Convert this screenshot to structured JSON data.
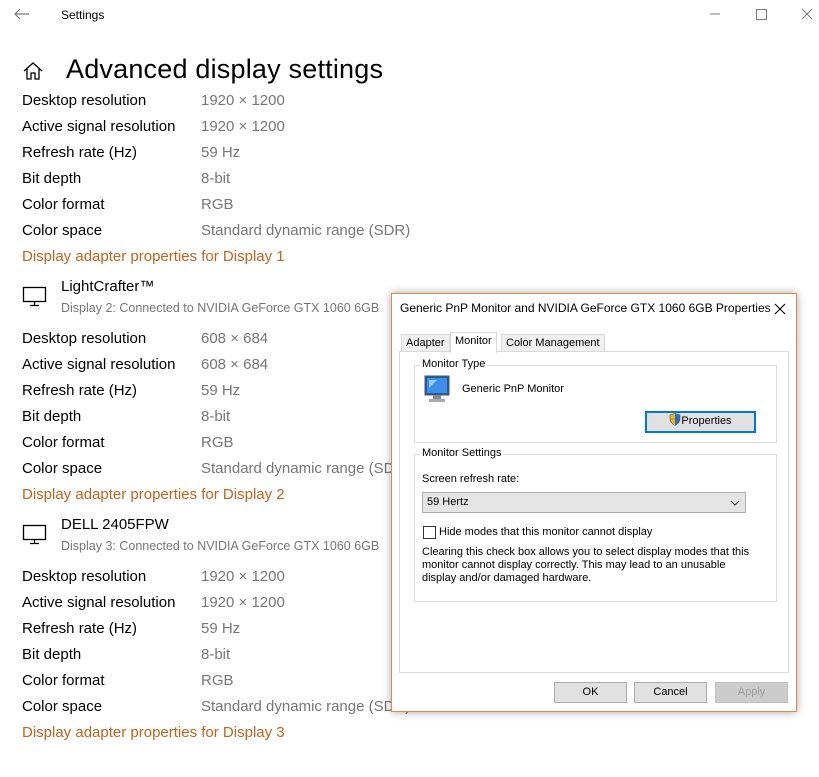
{
  "window": {
    "title": "Settings"
  },
  "page": {
    "title": "Advanced display settings"
  },
  "labels": {
    "desktop_resolution": "Desktop resolution",
    "active_signal_resolution": "Active signal resolution",
    "refresh_rate": "Refresh rate (Hz)",
    "bit_depth": "Bit depth",
    "color_format": "Color format",
    "color_space": "Color space"
  },
  "displays": [
    {
      "desktop_resolution": "1920 × 1200",
      "active_signal_resolution": "1920 × 1200",
      "refresh_rate": "59 Hz",
      "bit_depth": "8-bit",
      "color_format": "RGB",
      "color_space": "Standard dynamic range (SDR)",
      "adapter_link": "Display adapter properties for Display 1"
    },
    {
      "monitor_name": "LightCrafter™",
      "monitor_sub": "Display 2: Connected to NVIDIA GeForce GTX 1060 6GB",
      "desktop_resolution": "608 × 684",
      "active_signal_resolution": "608 × 684",
      "refresh_rate": "59 Hz",
      "bit_depth": "8-bit",
      "color_format": "RGB",
      "color_space": "Standard dynamic range (SDR)",
      "adapter_link": "Display adapter properties for Display 2"
    },
    {
      "monitor_name": "DELL 2405FPW",
      "monitor_sub": "Display 3: Connected to NVIDIA GeForce GTX 1060 6GB",
      "desktop_resolution": "1920 × 1200",
      "active_signal_resolution": "1920 × 1200",
      "refresh_rate": "59 Hz",
      "bit_depth": "8-bit",
      "color_format": "RGB",
      "color_space": "Standard dynamic range (SDR)",
      "adapter_link": "Display adapter properties for Display 3"
    }
  ],
  "dialog": {
    "title": "Generic PnP Monitor and NVIDIA GeForce GTX 1060 6GB Properties",
    "tabs": [
      "Adapter",
      "Monitor",
      "Color Management"
    ],
    "active_tab": "Monitor",
    "monitor_type_label": "Monitor Type",
    "monitor_type_name": "Generic PnP Monitor",
    "properties_button": "Properties",
    "monitor_settings_label": "Monitor Settings",
    "refresh_rate_label": "Screen refresh rate:",
    "refresh_rate_value": "59 Hertz",
    "hide_modes_label": "Hide modes that this monitor cannot display",
    "hide_modes_checked": false,
    "hide_modes_help": "Clearing this check box allows you to select display modes that this monitor cannot display correctly. This may lead to an unusable display and/or damaged hardware.",
    "ok_button": "OK",
    "cancel_button": "Cancel",
    "apply_button": "Apply"
  },
  "colors": {
    "link": "#c2641c",
    "value_gray": "#767676",
    "dialog_border": "#e08a4a",
    "focus_blue": "#0078d7"
  },
  "icons": [
    "back-arrow-icon",
    "minimize-icon",
    "maximize-icon",
    "close-icon",
    "home-icon",
    "monitor-icon",
    "shield-icon",
    "chevron-down-icon"
  ]
}
